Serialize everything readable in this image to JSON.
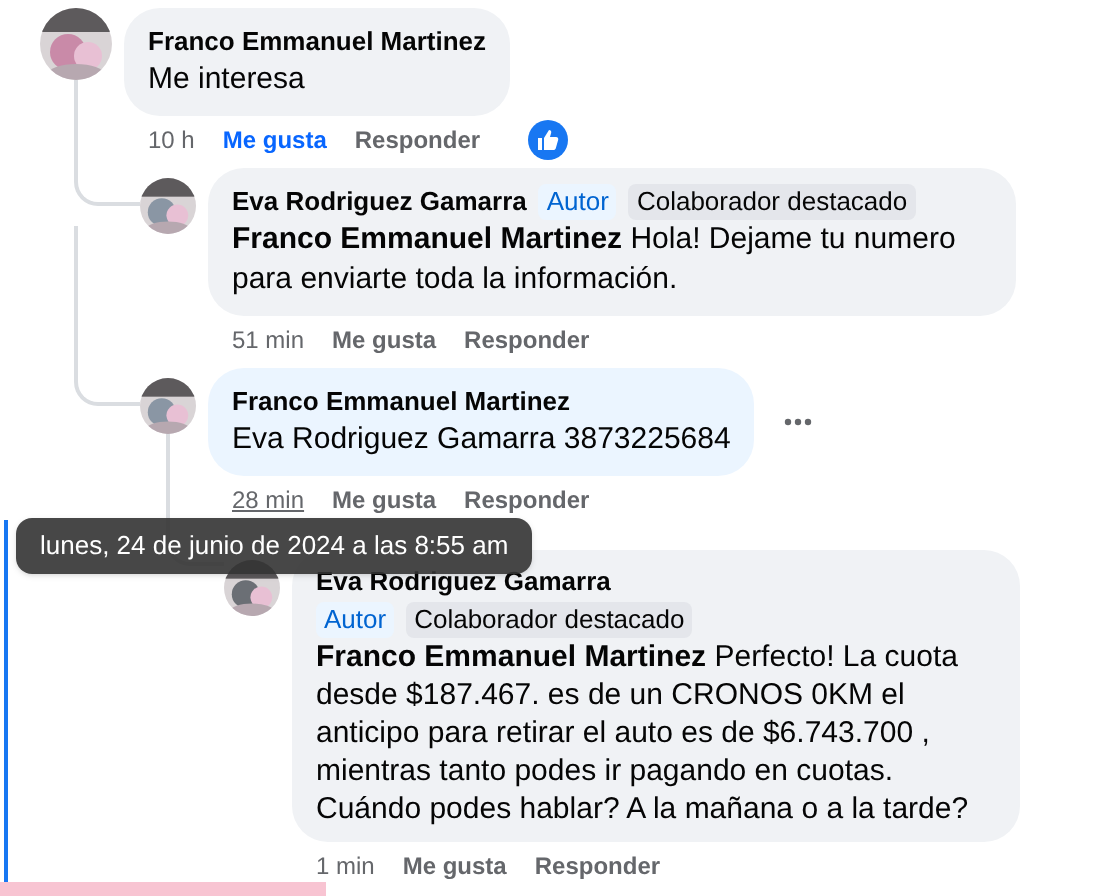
{
  "comments": [
    {
      "author": "Franco Emmanuel Martinez",
      "text": "Me interesa",
      "time": "10 h",
      "like": "Me gusta",
      "liked": true,
      "reply": "Responder",
      "reaction": true,
      "hovered": false,
      "highlighted": false,
      "children": [
        {
          "author": "Eva Rodriguez Gamarra",
          "badges": [
            {
              "label": "Autor",
              "kind": "author"
            },
            {
              "label": "Colaborador destacado",
              "kind": "top"
            }
          ],
          "mention": "Franco Emmanuel Martinez",
          "text": "Hola! Dejame tu numero para enviarte toda la información.",
          "time": "51 min",
          "like": "Me gusta",
          "liked": false,
          "reply": "Responder",
          "reaction": false,
          "hovered": false,
          "highlighted": false
        },
        {
          "author": "Franco Emmanuel Martinez",
          "text": "Eva Rodriguez Gamarra 3873225684",
          "time": "28 min",
          "like": "Me gusta",
          "liked": false,
          "reply": "Responder",
          "reaction": false,
          "hovered": true,
          "highlighted": false,
          "children": [
            {
              "author": "Eva Rodriguez Gamarra",
              "badges": [
                {
                  "label": "Autor",
                  "kind": "author"
                },
                {
                  "label": "Colaborador destacado",
                  "kind": "top"
                }
              ],
              "mention": "Franco Emmanuel Martinez",
              "text": "Perfecto! La cuota desde $187.467. es de un CRONOS 0KM el anticipo para retirar el auto es de $6.743.700 , mientras tanto podes ir pagando en cuotas. Cuándo podes hablar? A la mañana o a la tarde?",
              "time": "1 min",
              "like": "Me gusta",
              "liked": false,
              "reply": "Responder",
              "reaction": false,
              "hovered": false,
              "highlighted": true
            }
          ]
        }
      ]
    }
  ],
  "tooltip": {
    "text": "lunes, 24 de junio de 2024 a las 8:55 am"
  }
}
